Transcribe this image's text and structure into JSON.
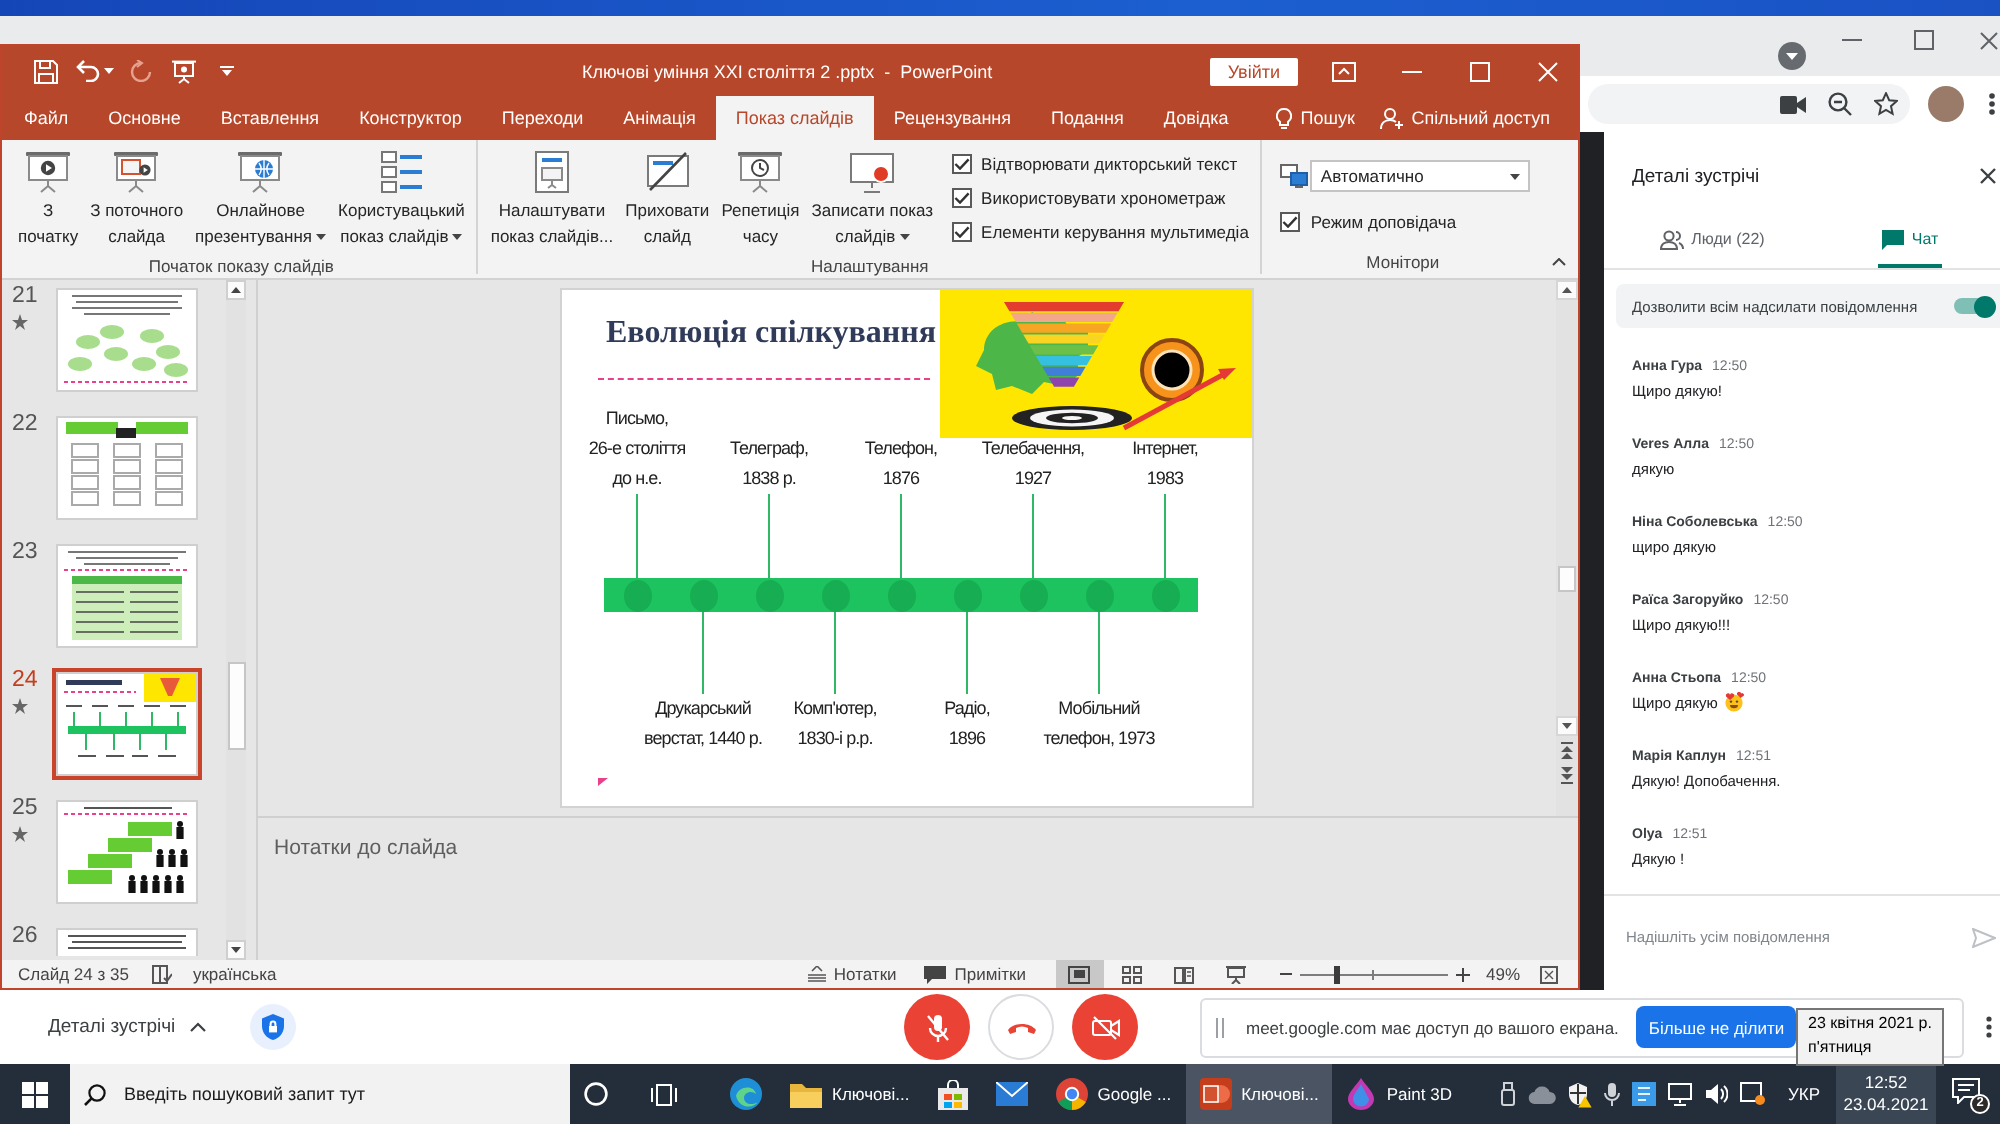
{
  "powerpoint": {
    "title": "Ключові уміння XXI століття 2 .pptx  -  PowerPoint",
    "sign_in": "Увійти",
    "tabs": [
      {
        "label": "Файл",
        "selected": false
      },
      {
        "label": "Основне",
        "selected": false
      },
      {
        "label": "Вставлення",
        "selected": false
      },
      {
        "label": "Конструктор",
        "selected": false
      },
      {
        "label": "Переходи",
        "selected": false
      },
      {
        "label": "Анімація",
        "selected": false
      },
      {
        "label": "Показ слайдів",
        "selected": true
      },
      {
        "label": "Рецензування",
        "selected": false
      },
      {
        "label": "Подання",
        "selected": false
      },
      {
        "label": "Довідка",
        "selected": false
      }
    ],
    "search": "Пошук",
    "share": "Спільний доступ",
    "ribbon_groups": [
      {
        "label": "Початок показу слайдів",
        "items": [
          {
            "kind": "button",
            "label": "З\nпочатку",
            "menu": false
          },
          {
            "kind": "button",
            "label": "З поточного\nслайда",
            "menu": false
          },
          {
            "kind": "button",
            "label": "Онлайнове\nпрезентування",
            "menu": true
          },
          {
            "kind": "button",
            "label": "Користувацький\nпоказ слайдів",
            "menu": true
          }
        ]
      },
      {
        "label": "Налаштування",
        "items": [
          {
            "kind": "button",
            "label": "Налаштувати\nпоказ слайдів...",
            "menu": false
          },
          {
            "kind": "button",
            "label": "Приховати\nслайд",
            "menu": false
          },
          {
            "kind": "button",
            "label": "Репетиція\nчасу",
            "menu": false
          },
          {
            "kind": "button",
            "label": "Записати показ\nслайдів",
            "menu": true
          },
          {
            "kind": "checkbox",
            "label": "Відтворювати дикторський текст",
            "checked": true
          },
          {
            "kind": "checkbox",
            "label": "Використовувати хронометраж",
            "checked": true
          },
          {
            "kind": "checkbox",
            "label": "Елементи керування мультимедіа",
            "checked": true
          }
        ]
      },
      {
        "label": "Монітори",
        "items": [
          {
            "kind": "select",
            "value": "Автоматично"
          },
          {
            "kind": "checkbox",
            "label": "Режим доповідача",
            "checked": true
          }
        ]
      }
    ],
    "slides": [
      {
        "number": "21",
        "kind": "mindmap",
        "animated": true,
        "selected": false
      },
      {
        "number": "22",
        "kind": "boxes",
        "animated": false,
        "selected": false
      },
      {
        "number": "23",
        "kind": "table",
        "animated": false,
        "selected": false
      },
      {
        "number": "24",
        "kind": "timeline",
        "animated": true,
        "selected": true
      },
      {
        "number": "25",
        "kind": "stairs",
        "animated": true,
        "selected": false
      },
      {
        "number": "26",
        "kind": "text",
        "animated": false,
        "selected": false
      }
    ],
    "slide": {
      "title": "Еволюція спілкування",
      "events": [
        {
          "label": "Письмо,\n26-е століття\nдо н.е.",
          "kind": "above"
        },
        {
          "label": "Друкарський\nверстат, 1440 р.",
          "kind": "below"
        },
        {
          "label": "Телеграф,\n1838 р.",
          "kind": "above"
        },
        {
          "label": "Комп'ютер,\n1830-і р.р.",
          "kind": "below"
        },
        {
          "label": "Телефон,\n1876",
          "kind": "above"
        },
        {
          "label": "Радіо,\n1896",
          "kind": "below"
        },
        {
          "label": "Телебачення,\n1927",
          "kind": "above"
        },
        {
          "label": "Мобільний\nтелефон, 1973",
          "kind": "below"
        },
        {
          "label": "Інтернет,\n1983",
          "kind": "above"
        }
      ]
    },
    "notes": {
      "placeholder": "Нотатки до слайда"
    },
    "status_bar": {
      "slide": "Слайд 24 з 35",
      "language": "українська",
      "notes": "Нотатки",
      "comments": "Примітки",
      "views": [
        {
          "kind": "normal",
          "selected": true
        },
        {
          "kind": "sorter",
          "selected": false
        },
        {
          "kind": "reading",
          "selected": false
        },
        {
          "kind": "slideshow",
          "selected": false
        }
      ],
      "zoom": {
        "level": 0.24,
        "reading": "49%"
      }
    }
  },
  "meet": {
    "panel": {
      "title": "Деталі зустрічі",
      "tabs": [
        {
          "kind": "people",
          "label": "Люди (22)",
          "selected": false
        },
        {
          "kind": "chat",
          "label": "Чат",
          "selected": true
        }
      ],
      "allow_messages": {
        "label": "Дозволити всім надсилати повідомлення",
        "on": true
      },
      "messages": [
        {
          "name": "Анна Гура",
          "time": "12:50",
          "text": "Щиро дякую!",
          "emoji": false
        },
        {
          "name": "Veres Алла",
          "time": "12:50",
          "text": "дякую",
          "emoji": false
        },
        {
          "name": "Ніна Соболевська",
          "time": "12:50",
          "text": "щиро дякую",
          "emoji": false
        },
        {
          "name": "Раїса Загоруйко",
          "time": "12:50",
          "text": "Щиро дякую!!!",
          "emoji": false
        },
        {
          "name": "Анна Стьопа",
          "time": "12:50",
          "text": "Щиро дякую",
          "emoji": true
        },
        {
          "name": "Марія Каплун",
          "time": "12:51",
          "text": "Дякую! Допобачення.",
          "emoji": false
        },
        {
          "name": "Olya",
          "time": "12:51",
          "text": "Дякую !",
          "emoji": false
        }
      ],
      "input": {
        "placeholder": "Надішліть усім повідомлення"
      }
    },
    "bottom_bar": {
      "details": "Деталі зустрічі",
      "mic_on": false,
      "camera_on": false
    },
    "share_notice": {
      "text": "meet.google.com має доступ до вашого екрана.",
      "button": "Більше не ділити"
    }
  },
  "date_tooltip": {
    "date": "23 квітня 2021 р.",
    "weekday": "п'ятниця"
  },
  "taskbar": {
    "search_placeholder": "Введіть пошуковий запит тут",
    "apps": [
      {
        "kind": "edge",
        "selected": false
      },
      {
        "kind": "explorer",
        "label": "Ключові...",
        "selected": false
      },
      {
        "kind": "store",
        "selected": false
      },
      {
        "kind": "mail",
        "selected": false
      },
      {
        "kind": "chrome",
        "label": "Google ...",
        "selected": false
      },
      {
        "kind": "powerpoint",
        "label": "Ключові...",
        "selected": true
      },
      {
        "kind": "paint3d",
        "label": "Paint 3D",
        "selected": false
      }
    ],
    "language": "УКР",
    "clock": {
      "time": "12:52",
      "date": "23.04.2021",
      "hovered": true
    },
    "notifications": "2"
  }
}
